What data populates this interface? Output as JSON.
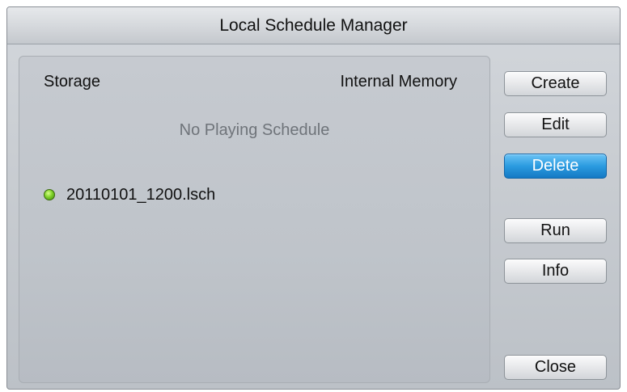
{
  "window": {
    "title": "Local Schedule Manager"
  },
  "storage": {
    "label": "Storage",
    "value": "Internal Memory"
  },
  "status": {
    "text": "No Playing Schedule"
  },
  "schedules": [
    {
      "name": "20110101_1200.lsch",
      "indicator_color": "#7fd12a"
    }
  ],
  "buttons": {
    "create": "Create",
    "edit": "Edit",
    "delete": "Delete",
    "run": "Run",
    "info": "Info",
    "close": "Close"
  },
  "colors": {
    "selected_button": "#2b9be0",
    "status_text": "#6f747a"
  }
}
